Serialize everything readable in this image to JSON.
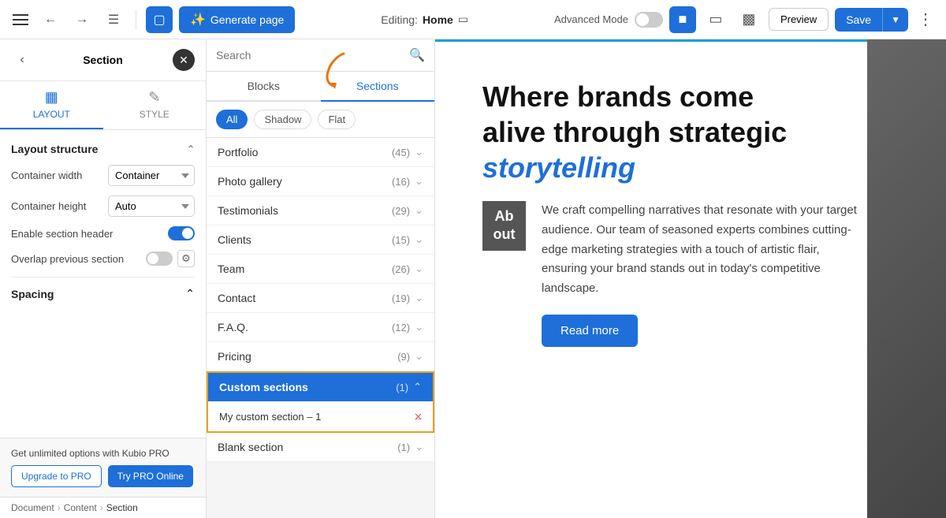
{
  "topbar": {
    "generate_label": "Generate page",
    "editing_label": "Editing:",
    "editing_page": "Home",
    "adv_mode_label": "Advanced Mode",
    "preview_label": "Preview",
    "save_label": "Save"
  },
  "left_panel": {
    "title": "Section",
    "tab_layout_label": "LAYOUT",
    "tab_style_label": "STYLE",
    "layout_structure_label": "Layout structure",
    "container_width_label": "Container width",
    "container_width_value": "Container",
    "container_height_label": "Container height",
    "container_height_value": "Auto",
    "enable_section_header_label": "Enable section header",
    "overlap_section_label": "Overlap previous section",
    "spacing_label": "Spacing",
    "footer_promo": "Get unlimited options with Kubio PRO",
    "upgrade_label": "Upgrade to PRO",
    "try_pro_label": "Try PRO Online"
  },
  "breadcrumb": {
    "items": [
      "Document",
      "Content",
      "Section"
    ]
  },
  "mid_panel": {
    "search_placeholder": "Search",
    "tab_blocks": "Blocks",
    "tab_sections": "Sections",
    "filter_all": "All",
    "filter_shadow": "Shadow",
    "filter_flat": "Flat",
    "sections_arrow_tooltip": "Sections tab indicator",
    "list_items": [
      {
        "label": "Portfolio",
        "count": "45",
        "expanded": false
      },
      {
        "label": "Photo gallery",
        "count": "16",
        "expanded": false
      },
      {
        "label": "Testimonials",
        "count": "29",
        "expanded": false
      },
      {
        "label": "Clients",
        "count": "15",
        "expanded": false
      },
      {
        "label": "Team",
        "count": "26",
        "expanded": false
      },
      {
        "label": "Contact",
        "count": "19",
        "expanded": false
      },
      {
        "label": "F.A.Q.",
        "count": "12",
        "expanded": false
      },
      {
        "label": "Pricing",
        "count": "9",
        "expanded": false
      },
      {
        "label": "Custom sections",
        "count": "1",
        "expanded": true
      },
      {
        "label": "Blank section",
        "count": "1",
        "expanded": false
      }
    ],
    "custom_section_name": "My custom section – 1"
  },
  "preview": {
    "heading_line1": "Where brands come",
    "heading_line2": "alive through strategic",
    "heading_italic": "storytelling",
    "body_text": "We craft compelling narratives that resonate with your target audience. Our team of seasoned experts combines cutting-edge marketing strategies with a touch of artistic flair, ensuring your brand stands out in today's competitive landscape.",
    "read_more_label": "Read more",
    "sidebar_letter": "Ab\nout"
  }
}
